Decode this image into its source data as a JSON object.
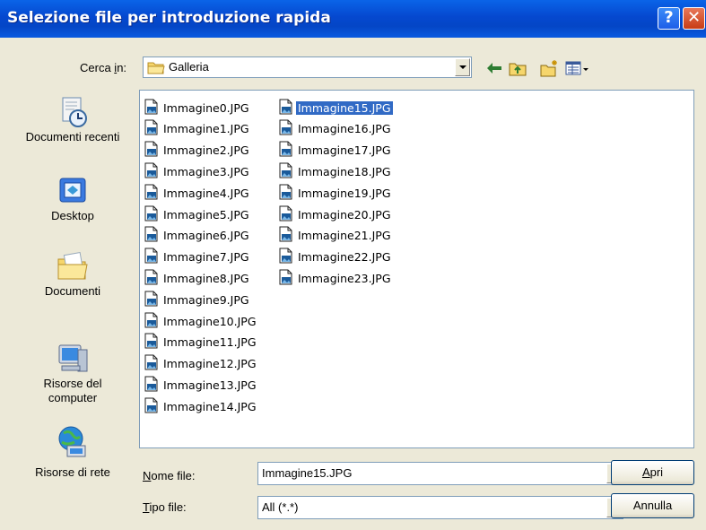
{
  "window": {
    "title": "Selezione file per introduzione rapida",
    "help_glyph": "?",
    "close_glyph": "✕"
  },
  "look_in": {
    "label_pre": "Cerca ",
    "label_key": "i",
    "label_post": "n:",
    "value": "Galleria"
  },
  "places": [
    {
      "label": "Documenti recenti",
      "icon": "recent-documents-icon"
    },
    {
      "label": "Desktop",
      "icon": "desktop-icon"
    },
    {
      "label": "Documenti",
      "icon": "my-documents-icon"
    },
    {
      "label": "Risorse del computer",
      "icon": "my-computer-icon"
    },
    {
      "label": "Risorse di rete",
      "icon": "network-places-icon"
    }
  ],
  "files": [
    "Immagine0.JPG",
    "Immagine1.JPG",
    "Immagine2.JPG",
    "Immagine3.JPG",
    "Immagine4.JPG",
    "Immagine5.JPG",
    "Immagine6.JPG",
    "Immagine7.JPG",
    "Immagine8.JPG",
    "Immagine9.JPG",
    "Immagine10.JPG",
    "Immagine11.JPG",
    "Immagine12.JPG",
    "Immagine13.JPG",
    "Immagine14.JPG",
    "Immagine15.JPG",
    "Immagine16.JPG",
    "Immagine17.JPG",
    "Immagine18.JPG",
    "Immagine19.JPG",
    "Immagine20.JPG",
    "Immagine21.JPG",
    "Immagine22.JPG",
    "Immagine23.JPG"
  ],
  "selected_file": "Immagine15.JPG",
  "filename": {
    "label_key": "N",
    "label_post": "ome file:",
    "value": "Immagine15.JPG"
  },
  "filetype": {
    "label_key": "T",
    "label_post": "ipo file:",
    "value": "All (*.*)"
  },
  "buttons": {
    "open_key": "A",
    "open_post": "pri",
    "cancel": "Annulla"
  },
  "colors": {
    "titlebar": "#0548cf",
    "selection": "#316ac5",
    "dialog_bg": "#ece9d8"
  }
}
